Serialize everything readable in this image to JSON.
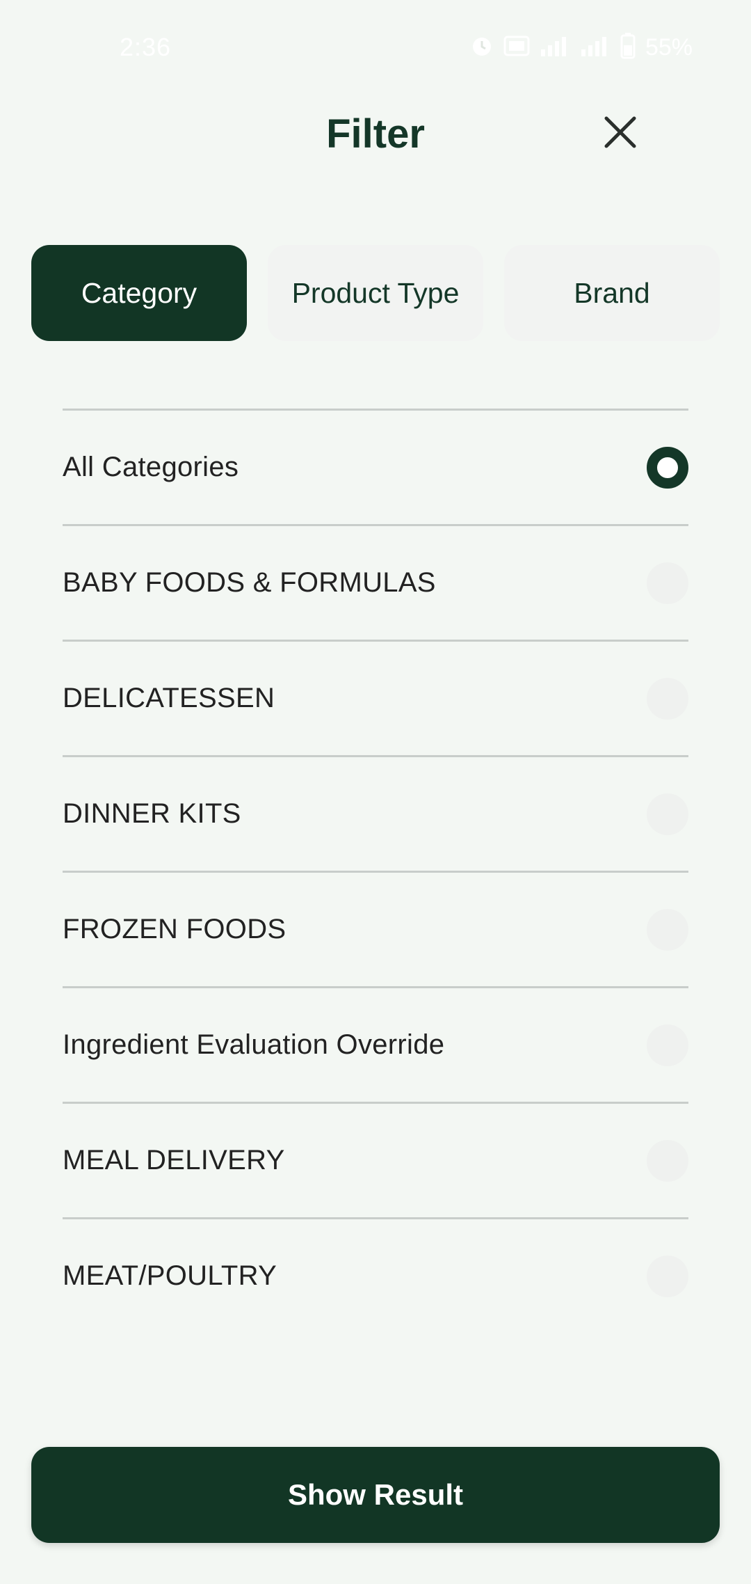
{
  "status_bar": {
    "time": "2:36",
    "battery": "55%",
    "icons": [
      "alarm-icon",
      "volte-icon",
      "signal-icon",
      "signal-icon",
      "battery-icon"
    ]
  },
  "header": {
    "title": "Filter",
    "close_icon": "close-icon"
  },
  "tabs": [
    {
      "label": "Category",
      "active": true
    },
    {
      "label": "Product Type",
      "active": false
    },
    {
      "label": "Brand",
      "active": false
    }
  ],
  "categories": [
    {
      "label": "All Categories",
      "selected": true
    },
    {
      "label": "BABY FOODS & FORMULAS",
      "selected": false
    },
    {
      "label": "DELICATESSEN",
      "selected": false
    },
    {
      "label": "DINNER KITS",
      "selected": false
    },
    {
      "label": "FROZEN FOODS",
      "selected": false
    },
    {
      "label": "Ingredient Evaluation Override",
      "selected": false
    },
    {
      "label": "MEAL DELIVERY",
      "selected": false
    },
    {
      "label": "MEAT/POULTRY",
      "selected": false
    }
  ],
  "footer": {
    "button_label": "Show Result"
  },
  "colors": {
    "primary": "#123625",
    "background": "#f3f7f3",
    "inactive_tab": "#f2f3f2",
    "divider": "#c8cdca"
  }
}
